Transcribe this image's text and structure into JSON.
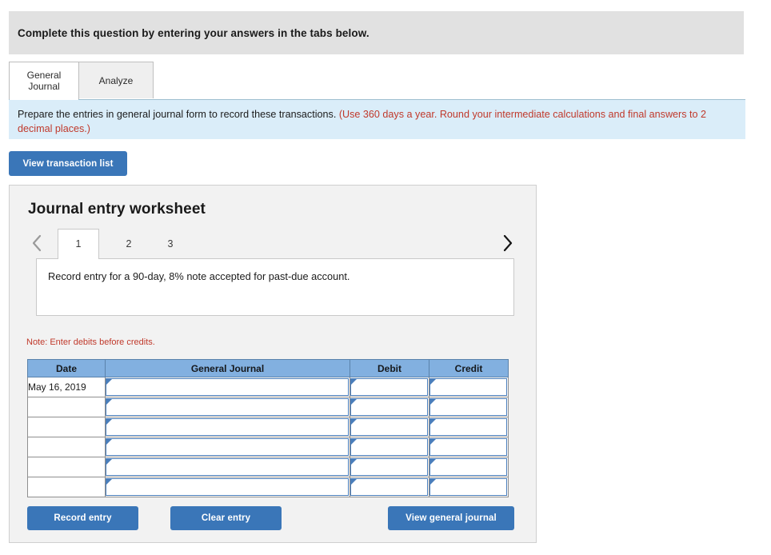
{
  "banner": {
    "text": "Complete this question by entering your answers in the tabs below."
  },
  "tabs": [
    {
      "label": "General\nJournal",
      "line1": "General",
      "line2": "Journal",
      "active": true
    },
    {
      "label": "Analyze",
      "line1": "Analyze",
      "line2": "",
      "active": false
    }
  ],
  "instruction": {
    "main": "Prepare the entries in general journal form to record these transactions. ",
    "emphasis": "(Use 360 days a year. Round your intermediate calculations and final answers to 2 decimal places.)"
  },
  "toolbar": {
    "view_transaction_list": "View transaction list"
  },
  "worksheet": {
    "title": "Journal entry worksheet",
    "prev_icon": "chevron-left-icon",
    "next_icon": "chevron-right-icon",
    "entry_tabs": [
      {
        "label": "1",
        "active": true
      },
      {
        "label": "2",
        "active": false
      },
      {
        "label": "3",
        "active": false
      }
    ],
    "description": "Record entry for a 90-day, 8% note accepted for past-due account.",
    "note": "Note: Enter debits before credits.",
    "table": {
      "headers": [
        "Date",
        "General Journal",
        "Debit",
        "Credit"
      ],
      "rows": [
        {
          "date": "May 16, 2019",
          "general_journal": "",
          "debit": "",
          "credit": ""
        },
        {
          "date": "",
          "general_journal": "",
          "debit": "",
          "credit": ""
        },
        {
          "date": "",
          "general_journal": "",
          "debit": "",
          "credit": ""
        },
        {
          "date": "",
          "general_journal": "",
          "debit": "",
          "credit": ""
        },
        {
          "date": "",
          "general_journal": "",
          "debit": "",
          "credit": ""
        },
        {
          "date": "",
          "general_journal": "",
          "debit": "",
          "credit": ""
        }
      ]
    },
    "buttons": {
      "record_entry": "Record entry",
      "clear_entry": "Clear entry",
      "view_general_journal": "View general journal"
    }
  },
  "colors": {
    "accent": "#3a76b8",
    "table_header": "#82b0e0",
    "instruction_bg": "#daedf9",
    "banner_bg": "#e1e1e1",
    "warning_text": "#c0392b",
    "panel_bg": "#f2f2f2"
  }
}
